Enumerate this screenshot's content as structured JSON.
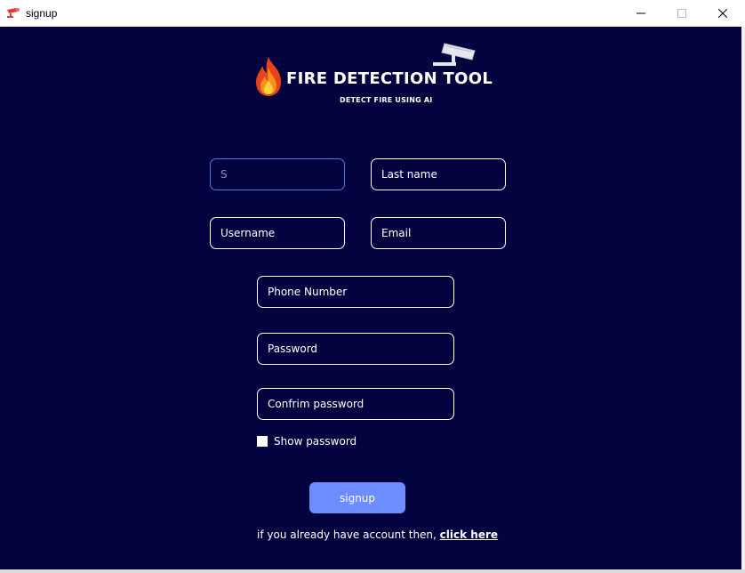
{
  "window": {
    "title": "signup",
    "icon": "camera-icon",
    "controls": [
      "minimize-icon",
      "maximize-icon",
      "close-icon"
    ]
  },
  "logo": {
    "title": "FIRE DETECTION TOOL",
    "subtitle": "DETECT FIRE USING AI",
    "icons": [
      "flame-icon",
      "security-camera-icon"
    ]
  },
  "form": {
    "first_name": {
      "value": "",
      "placeholder": "S"
    },
    "last_name": {
      "value": "",
      "placeholder": "Last name"
    },
    "username": {
      "value": "",
      "placeholder": "Username"
    },
    "email": {
      "value": "",
      "placeholder": "Email"
    },
    "phone": {
      "value": "",
      "placeholder": "Phone Number"
    },
    "password": {
      "value": "",
      "placeholder": "Password"
    },
    "confirm_password": {
      "value": "",
      "placeholder": "Confrim password"
    },
    "show_password": {
      "label": "Show password",
      "checked": false
    },
    "submit_label": "signup"
  },
  "footer": {
    "text": "if you already have account then, ",
    "link_label": "click here"
  },
  "colors": {
    "background": "#03033f",
    "button": "#6c8cff",
    "focus_border": "#5a74d8",
    "text": "#ffffff"
  }
}
